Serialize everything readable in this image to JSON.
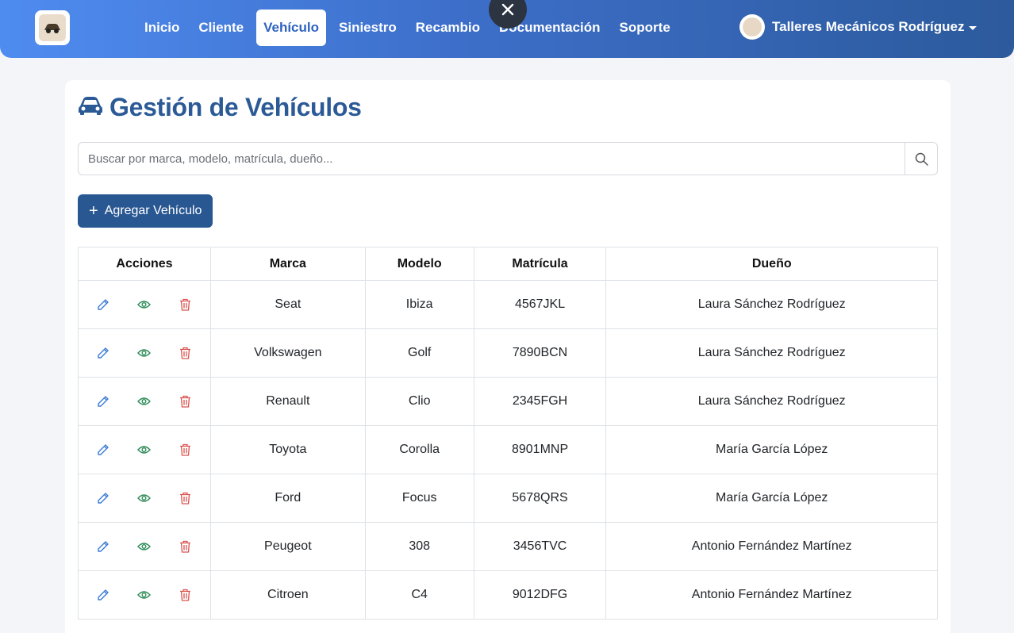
{
  "nav": {
    "links": [
      "Inicio",
      "Cliente",
      "Vehículo",
      "Siniestro",
      "Recambio",
      "Documentación",
      "Soporte"
    ],
    "active_index": 2,
    "user_name": "Talleres Mecánicos Rodríguez"
  },
  "page": {
    "title": "Gestión de Vehículos",
    "search_placeholder": "Buscar por marca, modelo, matrícula, dueño...",
    "add_button": "Agregar Vehículo"
  },
  "table": {
    "headers": [
      "Acciones",
      "Marca",
      "Modelo",
      "Matrícula",
      "Dueño"
    ],
    "rows": [
      {
        "marca": "Seat",
        "modelo": "Ibiza",
        "matricula": "4567JKL",
        "dueno": "Laura Sánchez Rodríguez"
      },
      {
        "marca": "Volkswagen",
        "modelo": "Golf",
        "matricula": "7890BCN",
        "dueno": "Laura Sánchez Rodríguez"
      },
      {
        "marca": "Renault",
        "modelo": "Clio",
        "matricula": "2345FGH",
        "dueno": "Laura Sánchez Rodríguez"
      },
      {
        "marca": "Toyota",
        "modelo": "Corolla",
        "matricula": "8901MNP",
        "dueno": "María García López"
      },
      {
        "marca": "Ford",
        "modelo": "Focus",
        "matricula": "5678QRS",
        "dueno": "María García López"
      },
      {
        "marca": "Peugeot",
        "modelo": "308",
        "matricula": "3456TVC",
        "dueno": "Antonio Fernández Martínez"
      },
      {
        "marca": "Citroen",
        "modelo": "C4",
        "matricula": "9012DFG",
        "dueno": "Antonio Fernández Martínez"
      }
    ]
  },
  "colors": {
    "edit": "#3a7bd5",
    "view": "#2e8b57",
    "delete": "#d9534f",
    "title": "#2b5a96"
  },
  "icons": {
    "edit": "pencil-icon",
    "view": "eye-icon",
    "delete": "trash-icon",
    "title": "car-icon",
    "search": "search-icon",
    "close": "close-icon"
  }
}
